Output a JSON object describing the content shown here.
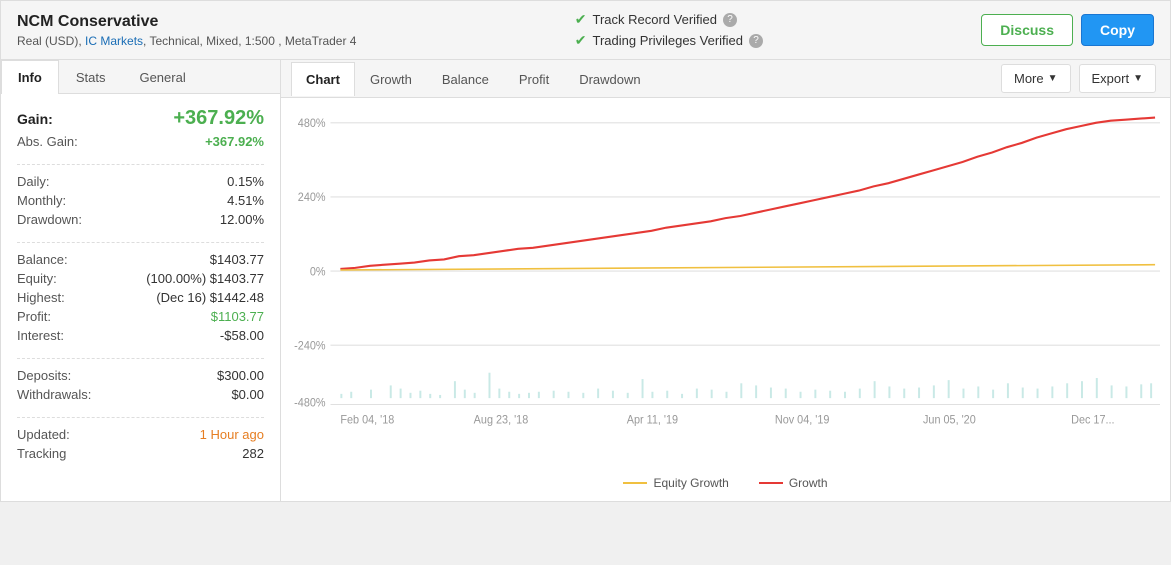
{
  "header": {
    "title": "NCM Conservative",
    "subtitle": "Real (USD), IC Markets, Technical, Mixed, 1:500 , MetaTrader 4",
    "broker_link": "IC Markets",
    "verified1": "Track Record Verified",
    "verified2": "Trading Privileges Verified",
    "btn_discuss": "Discuss",
    "btn_copy": "Copy"
  },
  "left_panel": {
    "tabs": [
      {
        "label": "Info",
        "active": true
      },
      {
        "label": "Stats",
        "active": false
      },
      {
        "label": "General",
        "active": false
      }
    ],
    "stats": {
      "gain_label": "Gain:",
      "gain_value": "+367.92%",
      "abs_gain_label": "Abs. Gain:",
      "abs_gain_value": "+367.92%",
      "daily_label": "Daily:",
      "daily_value": "0.15%",
      "monthly_label": "Monthly:",
      "monthly_value": "4.51%",
      "drawdown_label": "Drawdown:",
      "drawdown_value": "12.00%",
      "balance_label": "Balance:",
      "balance_value": "$1403.77",
      "equity_label": "Equity:",
      "equity_value": "(100.00%) $1403.77",
      "highest_label": "Highest:",
      "highest_value": "(Dec 16) $1442.48",
      "profit_label": "Profit:",
      "profit_value": "$1103.77",
      "interest_label": "Interest:",
      "interest_value": "-$58.00",
      "deposits_label": "Deposits:",
      "deposits_value": "$300.00",
      "withdrawals_label": "Withdrawals:",
      "withdrawals_value": "$0.00",
      "updated_label": "Updated:",
      "updated_value": "1 Hour ago",
      "tracking_label": "Tracking",
      "tracking_value": "282"
    }
  },
  "chart_panel": {
    "tabs": [
      {
        "label": "Chart",
        "active": true
      },
      {
        "label": "Growth",
        "active": false
      },
      {
        "label": "Balance",
        "active": false
      },
      {
        "label": "Profit",
        "active": false
      },
      {
        "label": "Drawdown",
        "active": false
      }
    ],
    "btn_more": "More",
    "btn_export": "Export",
    "y_labels": [
      "480%",
      "240%",
      "0%",
      "-240%",
      "-480%"
    ],
    "x_labels": [
      "Feb 04, '18",
      "Aug 23, '18",
      "Apr 11, '19",
      "Nov 04, '19",
      "Jun 05, '20",
      "Dec 17..."
    ],
    "legend": [
      {
        "label": "Equity Growth",
        "color": "yellow"
      },
      {
        "label": "Growth",
        "color": "red"
      }
    ]
  }
}
